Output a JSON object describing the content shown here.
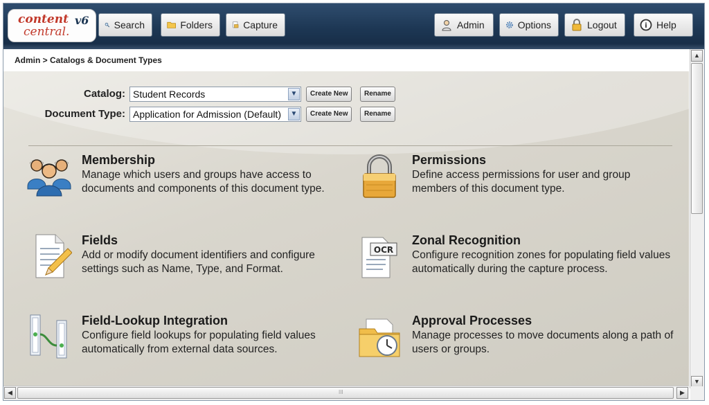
{
  "logo": {
    "line1": "content",
    "line2": "central.",
    "version": "v6"
  },
  "nav": {
    "search": "Search",
    "folders": "Folders",
    "capture": "Capture",
    "admin": "Admin",
    "options": "Options",
    "logout": "Logout",
    "help": "Help"
  },
  "breadcrumb": "Admin > Catalogs & Document Types",
  "form": {
    "catalog_label": "Catalog:",
    "catalog_value": "Student Records",
    "doctype_label": "Document Type:",
    "doctype_value": "Application for Admission (Default)",
    "create_new": "Create New",
    "rename": "Rename"
  },
  "items": [
    {
      "title": "Membership",
      "desc": "Manage which users and groups have access to documents and components of this document type.",
      "icon": "users-group-icon"
    },
    {
      "title": "Permissions",
      "desc": "Define access permissions for user and group members of this document type.",
      "icon": "padlock-icon"
    },
    {
      "title": "Fields",
      "desc": "Add or modify document identifiers and configure settings such as Name, Type, and Format.",
      "icon": "document-pencil-icon"
    },
    {
      "title": "Zonal Recognition",
      "desc": "Configure recognition zones for populating field values automatically during the capture process.",
      "icon": "ocr-document-icon"
    },
    {
      "title": "Field-Lookup Integration",
      "desc": "Configure field lookups for populating field values automatically from external data sources.",
      "icon": "data-link-icon"
    },
    {
      "title": "Approval Processes",
      "desc": "Manage processes to move documents along a path of users or groups.",
      "icon": "folder-clock-icon"
    }
  ],
  "scrollbars": {
    "grip": "III"
  }
}
